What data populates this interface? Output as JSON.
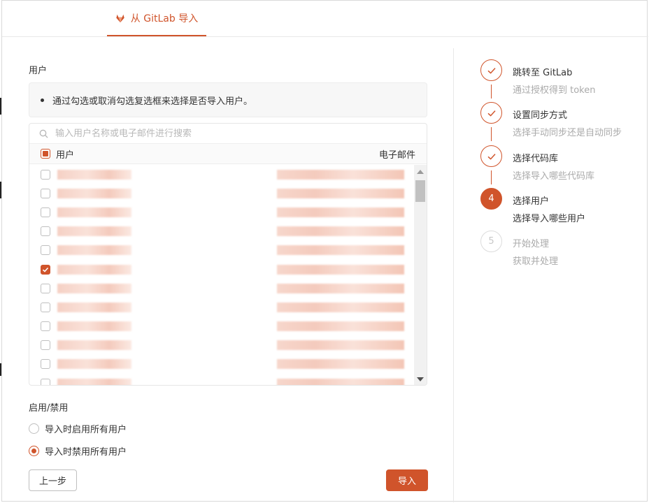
{
  "tab": {
    "label": "从 GitLab 导入"
  },
  "users_section": {
    "title": "用户",
    "tip": "通过勾选或取消勾选复选框来选择是否导入用户。",
    "search_placeholder": "输入用户名称或电子邮件进行搜索",
    "header": {
      "user_col": "用户",
      "email_col": "电子邮件"
    },
    "rows": [
      {
        "checked": false
      },
      {
        "checked": false
      },
      {
        "checked": false
      },
      {
        "checked": false
      },
      {
        "checked": false
      },
      {
        "checked": true
      },
      {
        "checked": false
      },
      {
        "checked": false
      },
      {
        "checked": false
      },
      {
        "checked": false
      },
      {
        "checked": false
      },
      {
        "checked": false
      }
    ]
  },
  "toggle_section": {
    "title": "启用/禁用",
    "options": [
      {
        "label": "导入时启用所有用户",
        "selected": false
      },
      {
        "label": "导入时禁用所有用户",
        "selected": true
      }
    ]
  },
  "buttons": {
    "prev": "上一步",
    "import": "导入"
  },
  "steps": [
    {
      "title": "跳转至 GitLab",
      "desc": "通过授权得到 token",
      "state": "done"
    },
    {
      "title": "设置同步方式",
      "desc": "选择手动同步还是自动同步",
      "state": "done"
    },
    {
      "title": "选择代码库",
      "desc": "选择导入哪些代码库",
      "state": "done"
    },
    {
      "number": "4",
      "title": "选择用户",
      "desc": "选择导入哪些用户",
      "state": "current"
    },
    {
      "number": "5",
      "title": "开始处理",
      "desc": "获取并处理",
      "state": "todo"
    }
  ],
  "colors": {
    "accent": "#d0542b"
  }
}
